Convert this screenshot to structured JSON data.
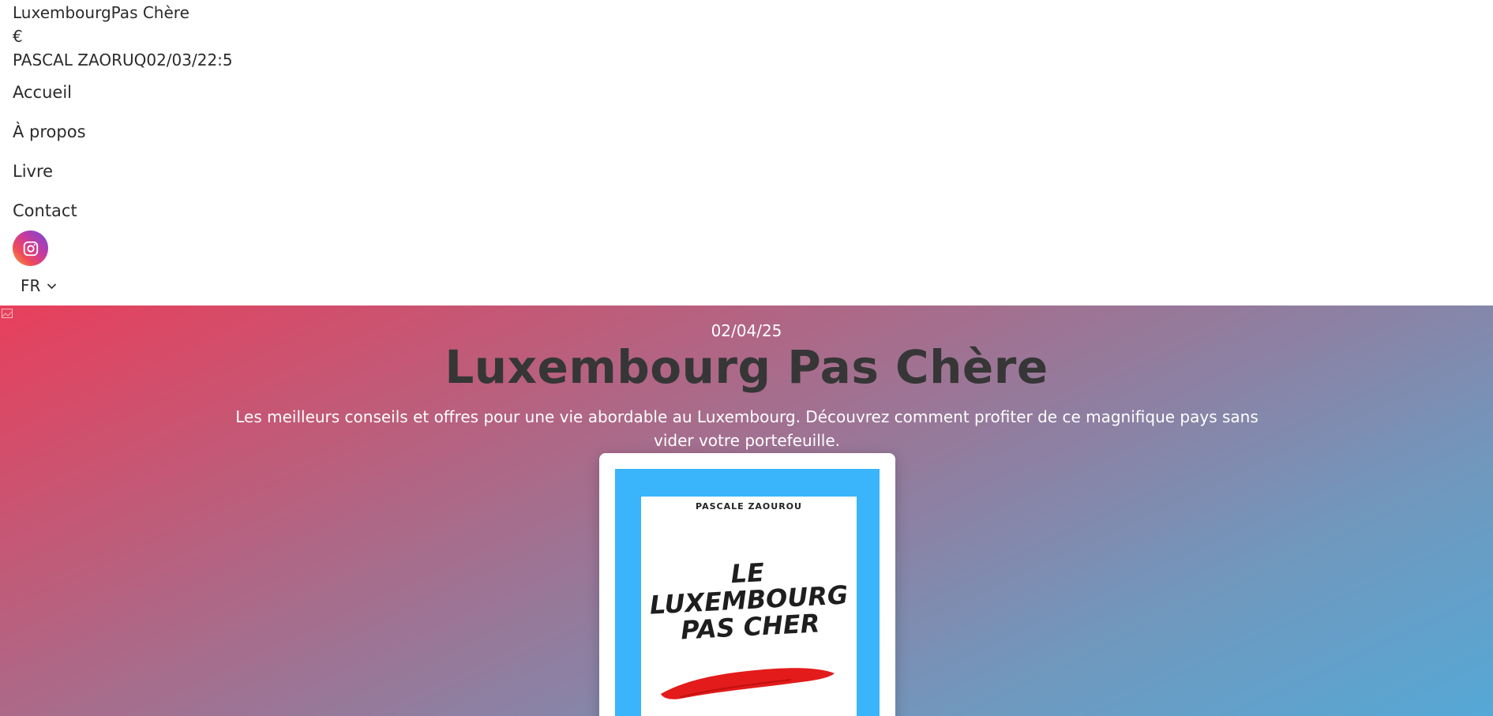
{
  "header": {
    "brand_line": "LuxembourgPas Chère",
    "currency_line": "€",
    "author_line": "PASCAL ZAORUQ02/03/22:5",
    "nav": [
      "Accueil",
      "À propos",
      "Livre",
      "Contact"
    ],
    "instagram_icon": "instagram-icon",
    "language": "FR"
  },
  "hero": {
    "date": "02/04/25",
    "title": "Luxembourg Pas Chère",
    "description": "Les meilleurs conseils et offres pour une vie abordable au Luxembourg. Découvrez comment profiter de ce magnifique pays sans vider votre portefeuille."
  },
  "book": {
    "author": "PASCALE ZAOUROU",
    "title_lines": [
      "LE",
      "LUXEMBOURG",
      "PAS CHER"
    ],
    "colors": {
      "frame": "#3ab4fb",
      "brush": "#e31b1b"
    }
  },
  "colors": {
    "gradient_start": "#e83f5b",
    "gradient_end": "#55a8d6",
    "text_dark": "#2b2b2b"
  }
}
